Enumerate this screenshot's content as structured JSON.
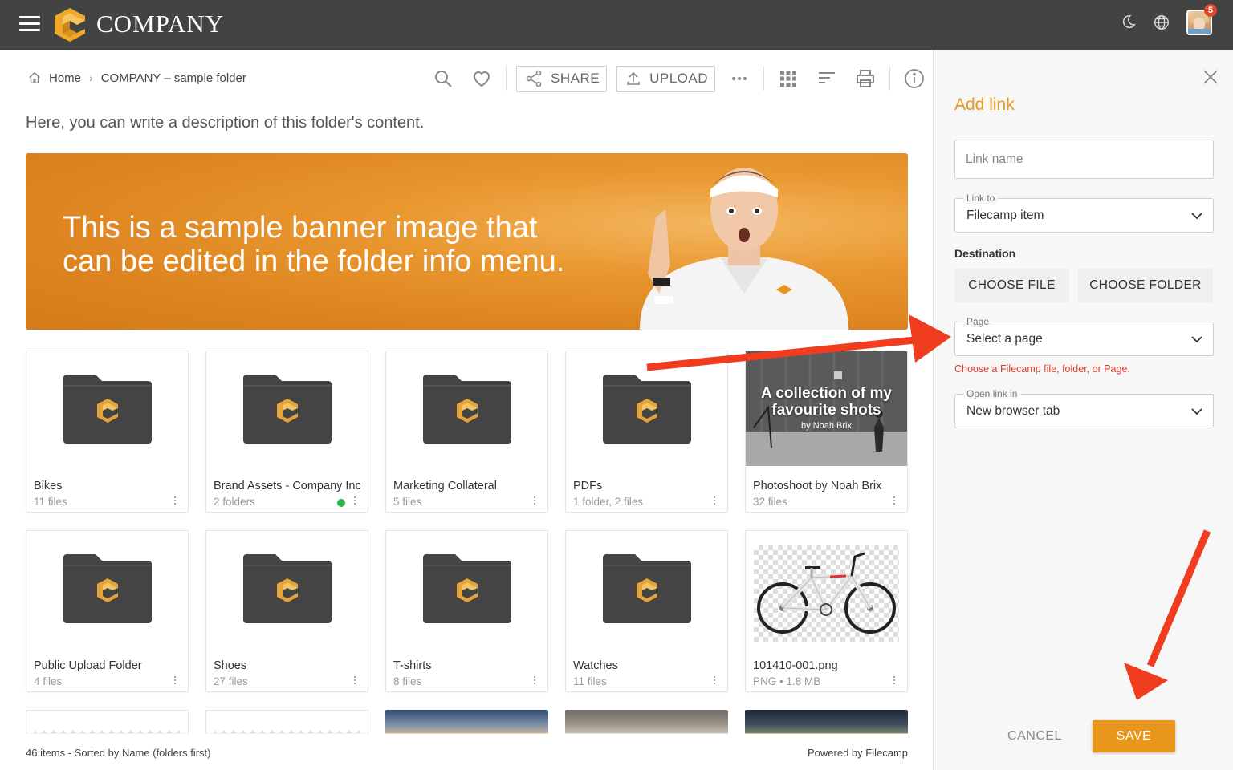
{
  "app": {
    "brand": "COMPANY",
    "notification_count": "5"
  },
  "breadcrumb": {
    "home": "Home",
    "current": "COMPANY – sample folder"
  },
  "toolbar": {
    "share_label": "SHARE",
    "upload_label": "UPLOAD"
  },
  "folder": {
    "description": "Here, you can write a description of this folder's content.",
    "banner_line1": "This is a sample banner image that",
    "banner_line2": "can be edited in the folder info menu."
  },
  "items": [
    {
      "name": "Bikes",
      "meta": "11 files",
      "type": "folder"
    },
    {
      "name": "Brand Assets - Company Inc",
      "meta": "2 folders",
      "type": "folder",
      "status": "online"
    },
    {
      "name": "Marketing Collateral",
      "meta": "5 files",
      "type": "folder"
    },
    {
      "name": "PDFs",
      "meta": "1 folder, 2 files",
      "type": "folder"
    },
    {
      "name": "Photoshoot by Noah Brix",
      "meta": "32 files",
      "type": "photo-folder",
      "thumb_title": "A collection of my favourite shots",
      "thumb_by": "by Noah Brix"
    },
    {
      "name": "Public Upload Folder",
      "meta": "4 files",
      "type": "folder"
    },
    {
      "name": "Shoes",
      "meta": "27 files",
      "type": "folder"
    },
    {
      "name": "T-shirts",
      "meta": "8 files",
      "type": "folder"
    },
    {
      "name": "Watches",
      "meta": "11 files",
      "type": "folder"
    },
    {
      "name": "101410-001.png",
      "meta": "PNG • 1.8 MB",
      "type": "image"
    }
  ],
  "footer": {
    "summary": "46 items - Sorted by Name (folders first)",
    "powered": "Powered by Filecamp"
  },
  "panel": {
    "title": "Add link",
    "link_name_placeholder": "Link name",
    "link_to_label": "Link to",
    "link_to_value": "Filecamp item",
    "destination_label": "Destination",
    "choose_file": "CHOOSE FILE",
    "choose_folder": "CHOOSE FOLDER",
    "page_label": "Page",
    "page_value": "Select a page",
    "error": "Choose a Filecamp file, folder, or Page.",
    "open_in_label": "Open link in",
    "open_in_value": "New browser tab",
    "cancel": "CANCEL",
    "save": "SAVE"
  },
  "colors": {
    "accent": "#e8961c",
    "topbar": "#434343",
    "error": "#e03a2a",
    "arrow": "#f03c1f"
  },
  "icons": [
    "menu-icon",
    "company-logo-icon",
    "moon-icon",
    "globe-icon",
    "home-icon",
    "search-icon",
    "heart-icon",
    "share-icon",
    "upload-icon",
    "more-icon",
    "grid-view-icon",
    "sort-icon",
    "print-icon",
    "info-icon",
    "close-icon",
    "chevron-down-icon"
  ]
}
